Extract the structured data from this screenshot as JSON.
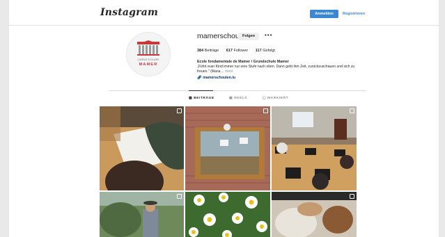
{
  "header": {
    "logo_text": "Instagram",
    "login_label": "Anmelden",
    "signup_label": "Registrieren"
  },
  "profile": {
    "username": "mamerschoul",
    "follow_label": "Folgen",
    "more_icon": "ellipsis-icon",
    "stats": {
      "posts_count": "384",
      "posts_label": "Beiträge",
      "followers_count": "617",
      "followers_label": "Follower",
      "following_count": "117",
      "following_label": "Gefolgt"
    },
    "full_name": "Ecole fondamentale de Mamer / Grundschule Mamer",
    "bio_text": "„Führt euer Kind immer nur eine Stufe nach oben. Dann gebt ihm Zeit, zurückzuschauen und sich zu freuen.\" (Maria…",
    "bio_more": "mehr",
    "website": "mamerschoulen.lu",
    "avatar_logo": {
      "line1": "CAMPUS SCOLAIRE",
      "line2": "MAMER"
    }
  },
  "tabs": [
    {
      "label": "BEITRÄGE",
      "icon": "grid-icon",
      "active": true
    },
    {
      "label": "REELS",
      "icon": "reels-icon",
      "active": false
    },
    {
      "label": "MARKIERT",
      "icon": "tag-icon",
      "active": false
    }
  ],
  "grid": {
    "posts": [
      {
        "subject": "children drawing on paper",
        "multi": true
      },
      {
        "subject": "terrarium in classroom window",
        "multi": true
      },
      {
        "subject": "students in computer classroom",
        "multi": true
      },
      {
        "subject": "child in garden",
        "multi": true
      },
      {
        "subject": "white daisy flowers",
        "multi": false
      },
      {
        "subject": "children sitting on floor",
        "multi": true
      }
    ]
  },
  "colors": {
    "accent": "#3b87d6",
    "text": "#262626",
    "muted": "#8e8e8e",
    "link": "#00376b",
    "logo_red": "#c8383b"
  }
}
